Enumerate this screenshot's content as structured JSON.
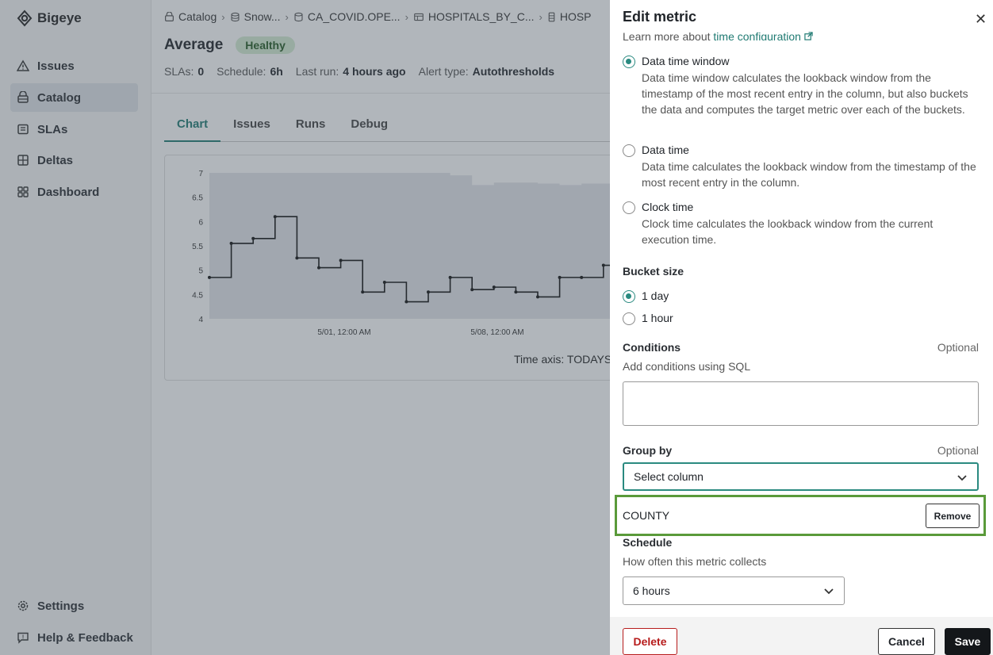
{
  "app": {
    "name": "Bigeye"
  },
  "sidebar": {
    "items": [
      {
        "label": "Issues",
        "icon": "warning-icon"
      },
      {
        "label": "Catalog",
        "icon": "catalog-icon"
      },
      {
        "label": "SLAs",
        "icon": "sla-icon"
      },
      {
        "label": "Deltas",
        "icon": "deltas-icon"
      },
      {
        "label": "Dashboard",
        "icon": "dashboard-icon"
      }
    ],
    "active": "Catalog",
    "bottom": [
      {
        "label": "Settings",
        "icon": "gear-icon"
      },
      {
        "label": "Help & Feedback",
        "icon": "help-icon"
      }
    ]
  },
  "breadcrumb": [
    "Catalog",
    "Snow...",
    "CA_COVID.OPE...",
    "HOSPITALS_BY_C...",
    "HOSP"
  ],
  "metric": {
    "title": "Average",
    "status": "Healthy",
    "meta": [
      {
        "label": "SLAs:",
        "value": "0"
      },
      {
        "label": "Schedule:",
        "value": "6h"
      },
      {
        "label": "Last run:",
        "value": "4 hours ago"
      },
      {
        "label": "Alert type:",
        "value": "Autothresholds"
      }
    ]
  },
  "tabs": [
    "Chart",
    "Issues",
    "Runs",
    "Debug"
  ],
  "active_tab": "Chart",
  "chart_data": {
    "type": "line",
    "y_ticks": [
      "7",
      "6.5",
      "6",
      "5.5",
      "5",
      "4.5",
      "4"
    ],
    "ylim": [
      4,
      7
    ],
    "x_tick_labels": [
      "5/01, 12:00 AM",
      "5/08, 12:00 AM"
    ],
    "x_axis_caption": "Time axis: TODAYS",
    "series": [
      {
        "values": [
          4.85,
          5.55,
          5.65,
          6.1,
          5.25,
          5.05,
          5.2,
          4.55,
          4.75,
          4.35,
          4.55,
          4.85,
          4.6,
          4.65,
          4.55,
          4.45,
          4.85,
          4.85,
          5.1
        ]
      }
    ],
    "band_upper": [
      7.0,
      7.0,
      7.0,
      7.0,
      7.0,
      7.0,
      7.0,
      7.0,
      7.0,
      7.0,
      7.0,
      6.95,
      6.75,
      6.8,
      6.8,
      6.78,
      6.75,
      6.78,
      6.78,
      6.8
    ],
    "band_lower": 4.0
  },
  "drawer": {
    "title": "Edit metric",
    "close_icon": "close-icon",
    "learn_prefix": "Learn more about",
    "learn_link": "time configuration",
    "time_options": [
      {
        "label": "Data time window",
        "checked": true,
        "desc": "Data time window calculates the lookback window from the timestamp of the most recent entry in the column, but also buckets the data and computes the target metric over each of the buckets."
      },
      {
        "label": "Data time",
        "checked": false,
        "desc": "Data time calculates the lookback window from the timestamp of the most recent entry in the column."
      },
      {
        "label": "Clock time",
        "checked": false,
        "desc": "Clock time calculates the lookback window from the current execution time."
      }
    ],
    "bucket_size": {
      "label": "Bucket size",
      "options": [
        {
          "label": "1 day",
          "checked": true
        },
        {
          "label": "1 hour",
          "checked": false
        }
      ]
    },
    "conditions": {
      "label": "Conditions",
      "optional": "Optional",
      "help": "Add conditions using SQL",
      "value": ""
    },
    "group_by": {
      "label": "Group by",
      "optional": "Optional",
      "select_placeholder": "Select column",
      "selected": "COUNTY",
      "remove_label": "Remove"
    },
    "schedule": {
      "label": "Schedule",
      "help": "How often this metric collects",
      "value": "6 hours"
    },
    "footer": {
      "delete": "Delete",
      "cancel": "Cancel",
      "save": "Save"
    }
  }
}
